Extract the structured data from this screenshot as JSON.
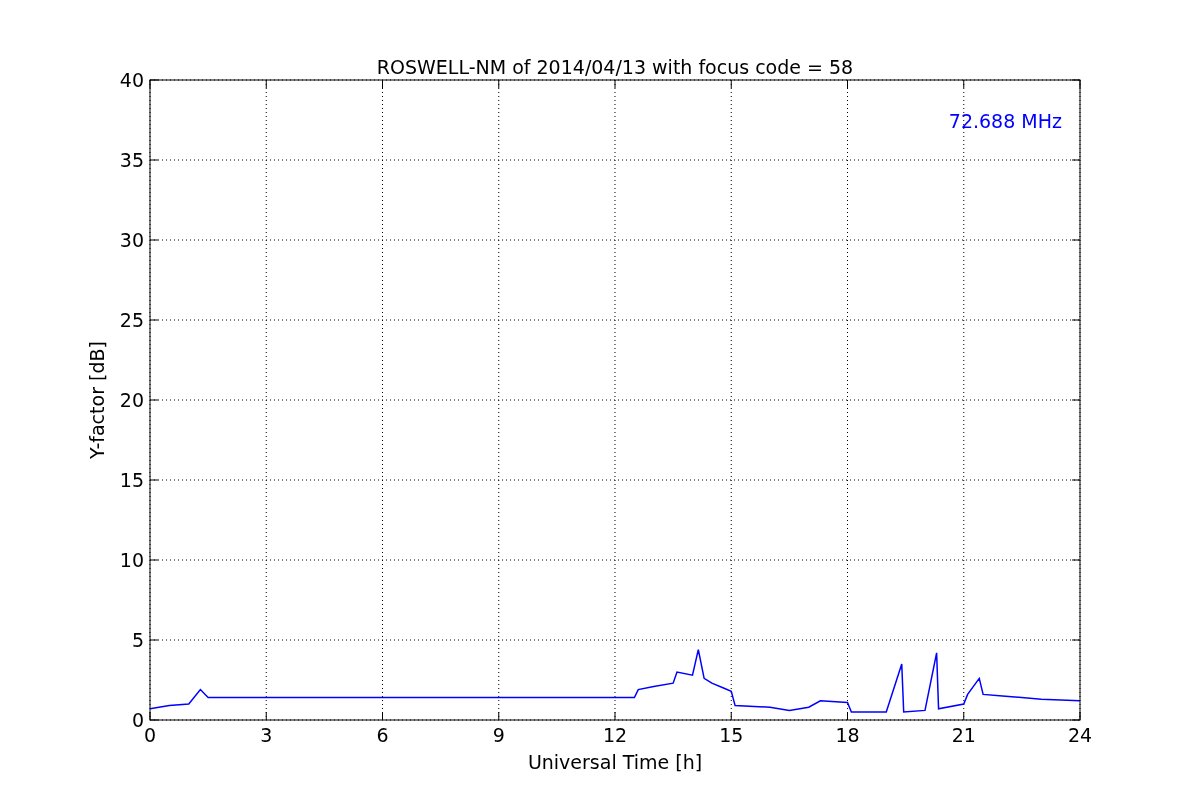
{
  "chart_data": {
    "type": "line",
    "title": "ROSWELL-NM of 2014/04/13 with focus code = 58",
    "xlabel": "Universal Time [h]",
    "ylabel": "Y-factor [dB]",
    "x": [
      0,
      0.5,
      1,
      1.3,
      1.5,
      12.5,
      12.6,
      13,
      13.5,
      13.6,
      14,
      14.15,
      14.3,
      14.5,
      14.8,
      15,
      15.1,
      16,
      16.5,
      17,
      17.3,
      18,
      18.1,
      19,
      19.4,
      19.45,
      20,
      20.3,
      20.35,
      21,
      21.1,
      21.4,
      21.5,
      22,
      23,
      24
    ],
    "series": [
      {
        "name": "72.688 MHz",
        "color": "#0000ff",
        "values": [
          0.7,
          0.9,
          1.0,
          1.9,
          1.4,
          1.4,
          1.9,
          2.1,
          2.3,
          3.0,
          2.8,
          4.4,
          2.6,
          2.3,
          2.0,
          1.8,
          0.9,
          0.8,
          0.6,
          0.8,
          1.2,
          1.1,
          0.5,
          0.5,
          3.5,
          0.5,
          0.6,
          4.2,
          0.7,
          1.0,
          1.6,
          2.6,
          1.6,
          1.5,
          1.3,
          1.2
        ]
      }
    ],
    "xlim": [
      0,
      24
    ],
    "ylim": [
      0,
      40
    ],
    "xticks": [
      0,
      3,
      6,
      9,
      12,
      15,
      18,
      21,
      24
    ],
    "yticks": [
      0,
      5,
      10,
      15,
      20,
      25,
      30,
      35,
      40
    ],
    "grid": true
  }
}
